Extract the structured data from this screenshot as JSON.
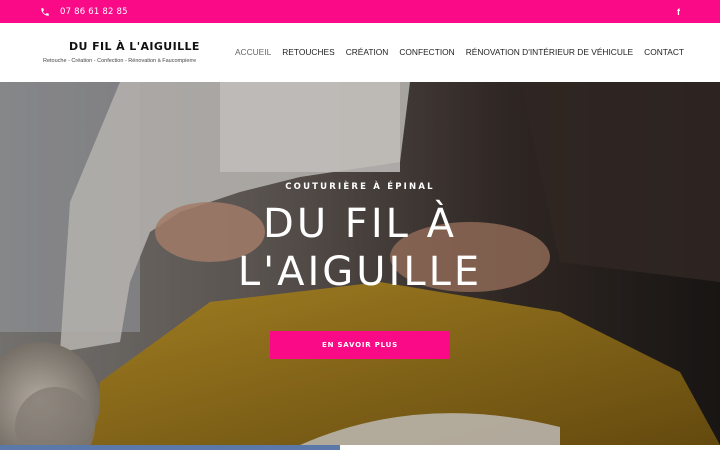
{
  "topbar": {
    "phone": "07 86 61 82 85",
    "phone_icon": "phone-icon",
    "social_icon": "facebook-icon",
    "social_glyph": "f",
    "accent": "#fb0a87"
  },
  "header": {
    "logo_title": "DU FIL À L'AIGUILLE",
    "logo_tagline": "Retouche - Création - Confection - Rénovation à Faucompierre"
  },
  "nav": {
    "items": [
      {
        "label": "ACCUEIL",
        "active": true
      },
      {
        "label": "RETOUCHES"
      },
      {
        "label": "CRÉATION"
      },
      {
        "label": "CONFECTION"
      },
      {
        "label": "RÉNOVATION D'INTÉRIEUR DE VÉHICULE"
      },
      {
        "label": "CONTACT"
      }
    ]
  },
  "hero": {
    "kicker": "COUTURIÈRE À ÉPINAL",
    "title_line1": "DU FIL À",
    "title_line2": "L'AIGUILLE",
    "cta": "EN SAVOIR PLUS",
    "cta_color": "#fb0a87"
  }
}
